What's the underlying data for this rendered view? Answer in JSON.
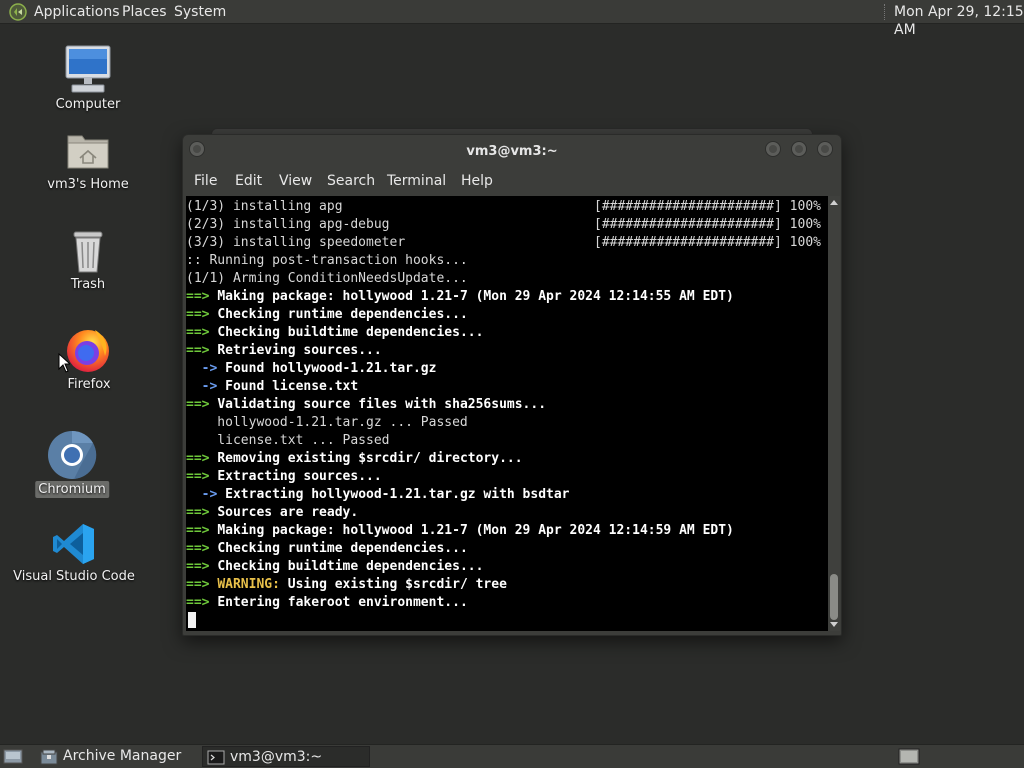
{
  "top_panel": {
    "menus": [
      "Applications",
      "Places",
      "System"
    ],
    "clock": "Mon Apr 29, 12:15 AM"
  },
  "desktop": {
    "icons": [
      {
        "label": "Computer",
        "icon": "computer-icon"
      },
      {
        "label": "vm3's Home",
        "icon": "home-folder-icon"
      },
      {
        "label": "Trash",
        "icon": "trash-icon"
      },
      {
        "label": "Firefox",
        "icon": "firefox-icon"
      },
      {
        "label": "Chromium",
        "icon": "chromium-icon"
      },
      {
        "label": "Visual Studio Code",
        "icon": "vscode-icon"
      }
    ]
  },
  "terminal": {
    "title": "vm3@vm3:~",
    "menu": [
      "File",
      "Edit",
      "View",
      "Search",
      "Terminal",
      "Help"
    ],
    "lines": [
      {
        "text": "(1/3) installing apg",
        "right": "[######################] 100%"
      },
      {
        "text": "(2/3) installing apg-debug",
        "right": "[######################] 100%"
      },
      {
        "text": "(3/3) installing speedometer",
        "right": "[######################] 100%"
      },
      {
        "text": ":: Running post-transaction hooks..."
      },
      {
        "text": "(1/1) Arming ConditionNeedsUpdate..."
      },
      {
        "prefix": "==> ",
        "text": "Making package: hollywood 1.21-7 (Mon 29 Apr 2024 12:14:55 AM EDT)"
      },
      {
        "prefix": "==> ",
        "text": "Checking runtime dependencies..."
      },
      {
        "prefix": "==> ",
        "text": "Checking buildtime dependencies..."
      },
      {
        "prefix": "==> ",
        "text": "Retrieving sources..."
      },
      {
        "prefix": "  -> ",
        "text": "Found hollywood-1.21.tar.gz"
      },
      {
        "prefix": "  -> ",
        "text": "Found license.txt"
      },
      {
        "prefix": "==> ",
        "text": "Validating source files with sha256sums..."
      },
      {
        "text": "    hollywood-1.21.tar.gz ... Passed"
      },
      {
        "text": "    license.txt ... Passed"
      },
      {
        "prefix": "==> ",
        "text": "Removing existing $srcdir/ directory..."
      },
      {
        "prefix": "==> ",
        "text": "Extracting sources..."
      },
      {
        "prefix": "  -> ",
        "text": "Extracting hollywood-1.21.tar.gz with bsdtar"
      },
      {
        "prefix": "==> ",
        "text": "Sources are ready."
      },
      {
        "prefix": "==> ",
        "text": "Making package: hollywood 1.21-7 (Mon 29 Apr 2024 12:14:59 AM EDT)"
      },
      {
        "prefix": "==> ",
        "text": "Checking runtime dependencies..."
      },
      {
        "prefix": "==> ",
        "text": "Checking buildtime dependencies..."
      },
      {
        "prefix": "==> ",
        "warn": "WARNING:",
        "text": " Using existing $srcdir/ tree"
      },
      {
        "prefix": "==> ",
        "text": "Entering fakeroot environment..."
      }
    ]
  },
  "taskbar": {
    "tasks": [
      {
        "label": "Archive Manager",
        "icon": "archive-manager-icon"
      },
      {
        "label": "vm3@vm3:~",
        "icon": "terminal-icon"
      }
    ]
  },
  "colors": {
    "desktop_bg": "#2b2c2a",
    "panel_bg": "#3a3b38",
    "terminal_bg": "#000000",
    "arrow_green": "#6fc93b",
    "warning_yellow": "#e9c14a"
  }
}
